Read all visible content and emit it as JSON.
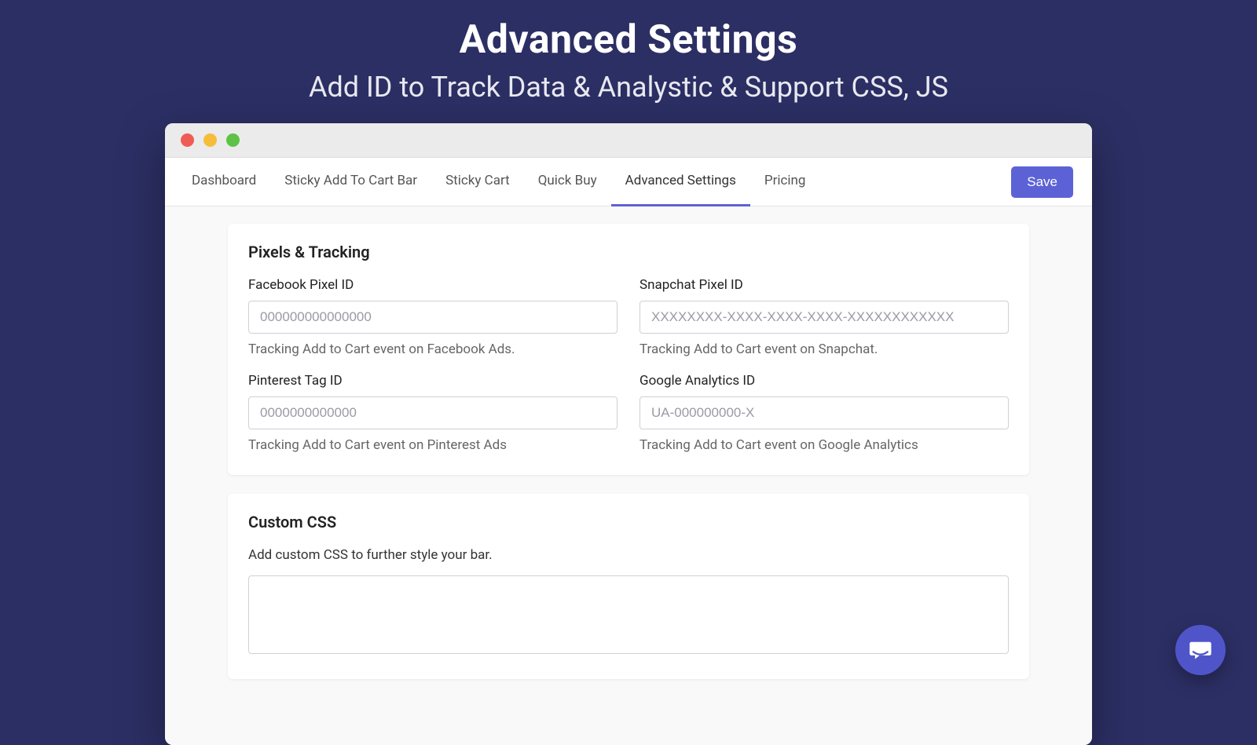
{
  "hero": {
    "title": "Advanced Settings",
    "subtitle": "Add ID to Track Data & Analystic & Support CSS, JS"
  },
  "tabs": [
    {
      "label": "Dashboard"
    },
    {
      "label": "Sticky Add To Cart Bar"
    },
    {
      "label": "Sticky Cart"
    },
    {
      "label": "Quick Buy"
    },
    {
      "label": "Advanced Settings"
    },
    {
      "label": "Pricing"
    }
  ],
  "active_tab_index": 4,
  "save_button": "Save",
  "pixels_card": {
    "title": "Pixels & Tracking",
    "fields": [
      {
        "label": "Facebook Pixel ID",
        "placeholder": "000000000000000",
        "help": "Tracking Add to Cart event on Facebook Ads."
      },
      {
        "label": "Snapchat Pixel ID",
        "placeholder": "XXXXXXXX-XXXX-XXXX-XXXX-XXXXXXXXXXXX",
        "help": "Tracking Add to Cart event on Snapchat."
      },
      {
        "label": "Pinterest Tag ID",
        "placeholder": "0000000000000",
        "help": "Tracking Add to Cart event on Pinterest Ads"
      },
      {
        "label": "Google Analytics ID",
        "placeholder": "UA-000000000-X",
        "help": "Tracking Add to Cart event on Google Analytics"
      }
    ]
  },
  "custom_css_card": {
    "title": "Custom CSS",
    "description": "Add custom CSS to further style your bar."
  }
}
